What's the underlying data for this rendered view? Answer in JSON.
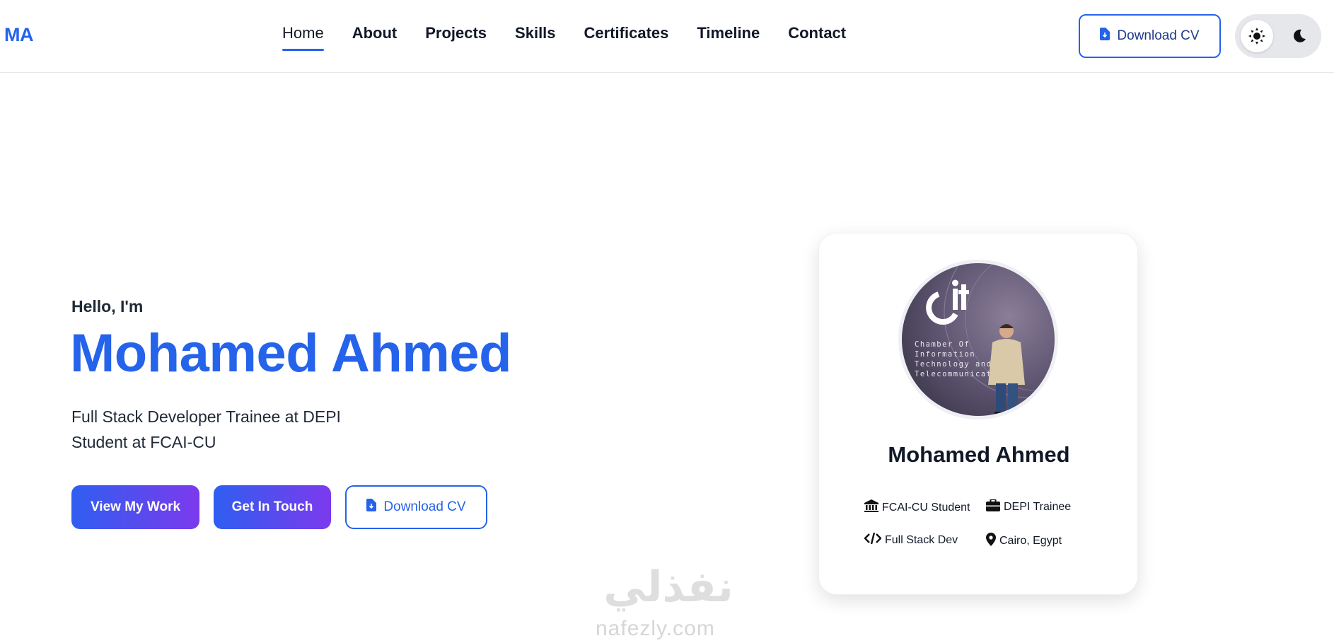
{
  "nav": {
    "logo": "MA",
    "items": [
      {
        "label": "Home",
        "active": true
      },
      {
        "label": "About"
      },
      {
        "label": "Projects"
      },
      {
        "label": "Skills"
      },
      {
        "label": "Certificates"
      },
      {
        "label": "Timeline"
      },
      {
        "label": "Contact"
      }
    ],
    "cv_button": "Download CV",
    "theme_icons": [
      "sun-icon",
      "moon-icon"
    ]
  },
  "hero": {
    "greeting": "Hello, I'm",
    "name": "Mohamed Ahmed",
    "role_line1": "Full Stack Developer Trainee at DEPI",
    "role_line2": "Student at FCAI-CU",
    "buttons": {
      "view_work": "View My Work",
      "get_in_touch": "Get In Touch",
      "download_cv": "Download CV"
    }
  },
  "card": {
    "name": "Mohamed Ahmed",
    "photo_caption": [
      "Chamber Of",
      "Information",
      "Technology and",
      "Telecommunication"
    ],
    "facts": [
      {
        "icon": "university-icon",
        "label": "FCAI-CU Student"
      },
      {
        "icon": "briefcase-icon",
        "label": "DEPI Trainee"
      },
      {
        "icon": "code-icon",
        "label": "Full Stack Dev"
      },
      {
        "icon": "map-pin-icon",
        "label": "Cairo, Egypt"
      }
    ]
  },
  "watermark": {
    "arabic": "نفذلي",
    "latin": "nafezly.com"
  },
  "colors": {
    "accent": "#2563eb",
    "gradient_start": "#2f5ef0",
    "gradient_end": "#7c3aed",
    "text": "#111827"
  }
}
